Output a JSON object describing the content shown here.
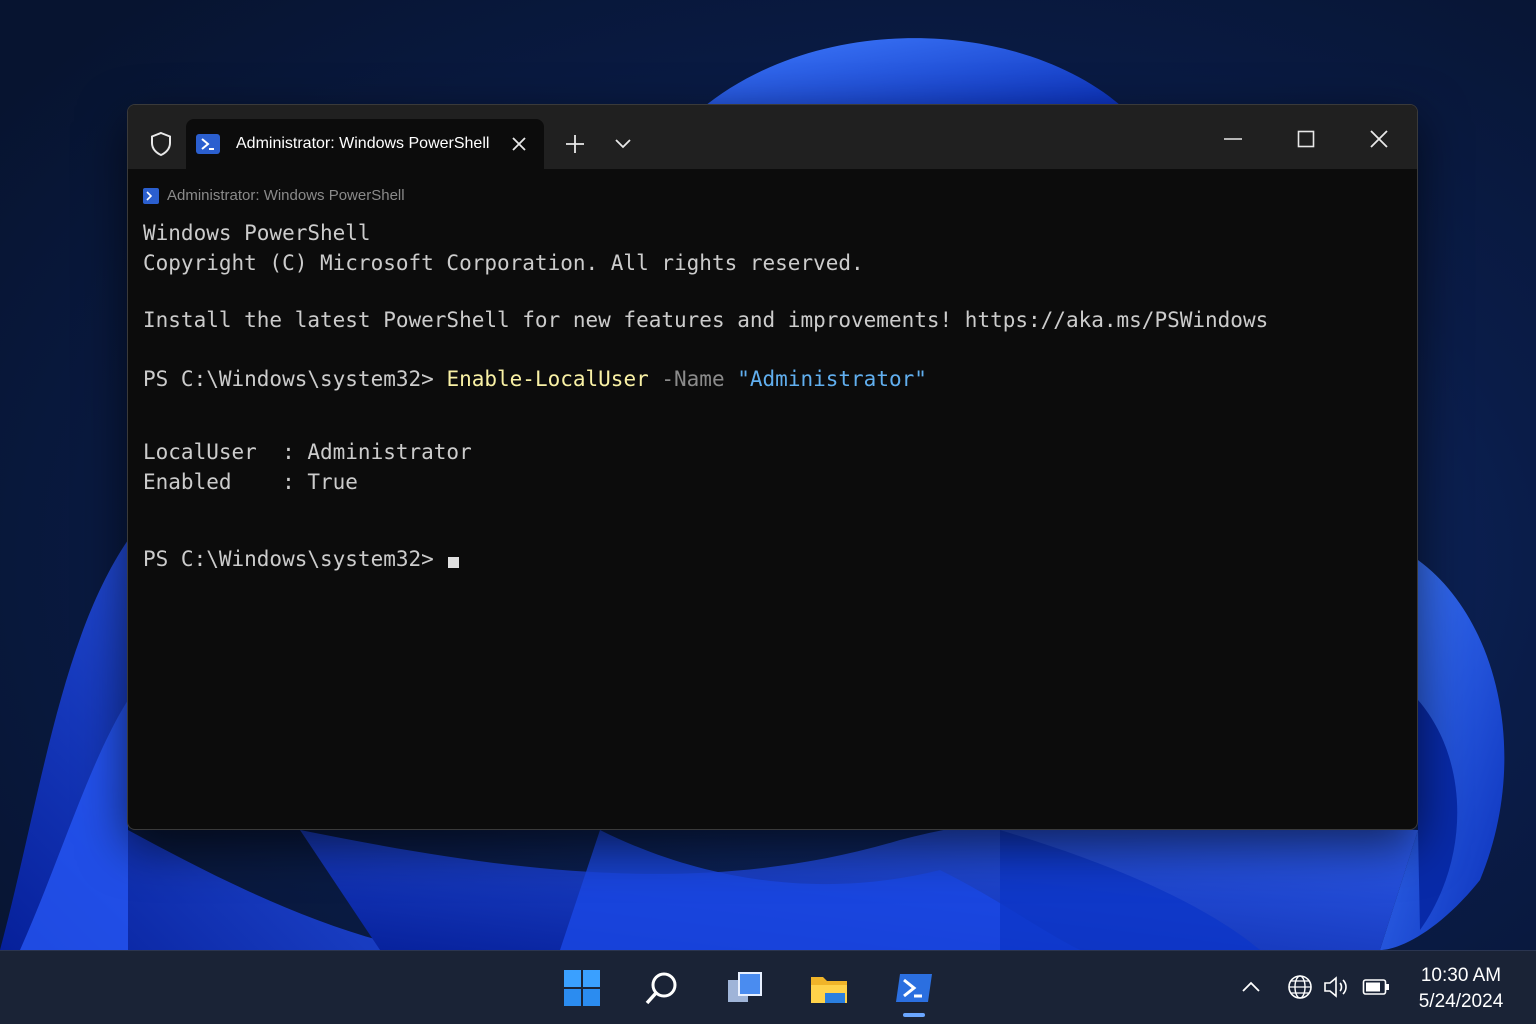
{
  "window": {
    "tab_title": "Administrator: Windows PowerShell"
  },
  "terminal": {
    "ghost_title": "Administrator: Windows PowerShell",
    "banner_line1": "Windows PowerShell",
    "banner_line2": "Copyright (C) Microsoft Corporation. All rights reserved.",
    "install_line": "Install the latest PowerShell for new features and improvements! https://aka.ms/PSWindows",
    "prompt": "PS C:\\Windows\\system32> ",
    "command": "Enable-LocalUser",
    "param": " -Name ",
    "arg": "\"Administrator\"",
    "output_line1": "LocalUser  : Administrator",
    "output_line2": "Enabled    : True",
    "prompt2": "PS C:\\Windows\\system32> "
  },
  "taskbar": {
    "icons": [
      "start-icon",
      "search-icon",
      "task-view-icon",
      "file-explorer-icon",
      "powershell-icon"
    ],
    "tray": [
      "chevron-up-icon",
      "globe-icon",
      "volume-icon",
      "battery-icon"
    ],
    "time": "10:30 AM",
    "date": "5/24/2024"
  },
  "colors": {
    "command": "#f9f1a5",
    "parameter": "#8b8b8b",
    "string": "#61afef",
    "accent": "#2b5fcf"
  }
}
